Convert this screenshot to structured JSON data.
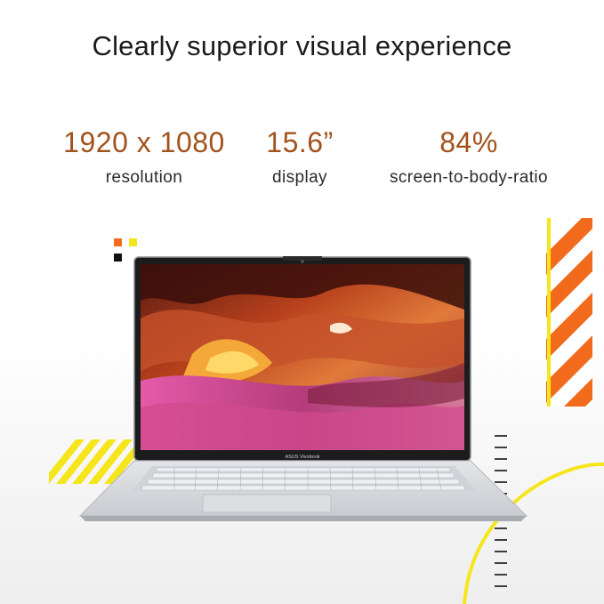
{
  "headline": "Clearly superior visual experience",
  "specs": [
    {
      "value": "1920 x 1080",
      "label": "resolution"
    },
    {
      "value": "15.6”",
      "label": "display"
    },
    {
      "value": "84%",
      "label": "screen-to-body-ratio"
    }
  ],
  "laptop": {
    "brand_label": "ASUS Vivobook"
  },
  "colors": {
    "accent_text": "#a2521c",
    "stripe_orange": "#f26a1b",
    "stripe_yellow": "#f5e61c",
    "bezel": "#1c1c1c",
    "chassis": "#d7d9dc"
  },
  "icons": [
    "orange-square",
    "yellow-square",
    "black-square"
  ]
}
